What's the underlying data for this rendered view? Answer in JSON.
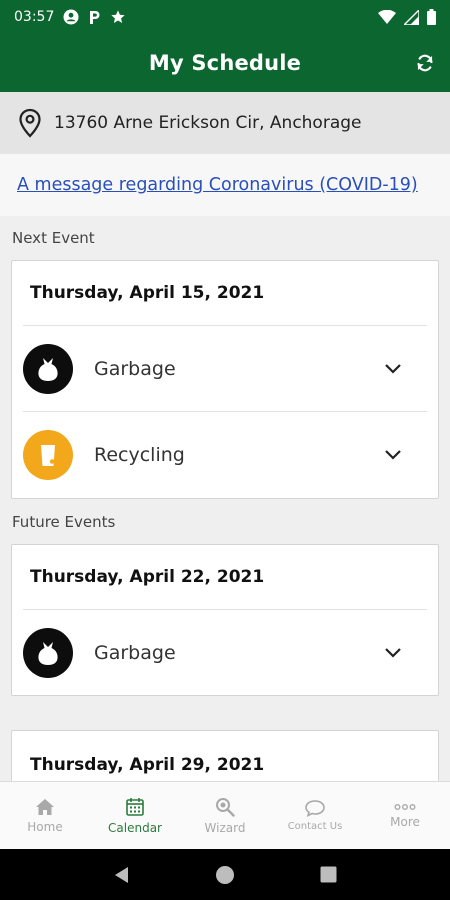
{
  "status_bar": {
    "time": "03:57",
    "icons": [
      "account-circle-icon",
      "parking-icon",
      "star-icon",
      "wifi-icon",
      "signal-icon",
      "battery-icon"
    ]
  },
  "app_bar": {
    "title": "My Schedule",
    "refresh_icon": "refresh-icon"
  },
  "address": {
    "icon": "location-pin-icon",
    "text": "13760 Arne Erickson Cir, Anchorage"
  },
  "notice": {
    "link_text": "A message regarding Coronavirus (COVID-19)"
  },
  "next_event": {
    "label": "Next Event",
    "date": "Thursday, April 15, 2021",
    "items": [
      {
        "label": "Garbage",
        "icon": "garbage-bag-icon",
        "color": "#0d0d0d"
      },
      {
        "label": "Recycling",
        "icon": "recycling-bin-icon",
        "color": "#f3a81b"
      }
    ]
  },
  "future_events": {
    "label": "Future Events",
    "events": [
      {
        "date": "Thursday, April 22, 2021",
        "items": [
          {
            "label": "Garbage",
            "icon": "garbage-bag-icon",
            "color": "#0d0d0d"
          }
        ]
      },
      {
        "date": "Thursday, April 29, 2021"
      }
    ]
  },
  "bottom_nav": {
    "items": [
      {
        "label": "Home",
        "icon": "home-icon",
        "active": false
      },
      {
        "label": "Calendar",
        "icon": "calendar-icon",
        "active": true
      },
      {
        "label": "Wizard",
        "icon": "search-icon",
        "active": false
      },
      {
        "label": "Contact Us",
        "icon": "chat-bubble-icon",
        "active": false
      },
      {
        "label": "More",
        "icon": "more-dots-icon",
        "active": false
      }
    ]
  },
  "colors": {
    "brand": "#0c6630",
    "active_nav": "#2d7a3e",
    "link": "#2a4fb7",
    "recycling": "#f3a81b"
  }
}
